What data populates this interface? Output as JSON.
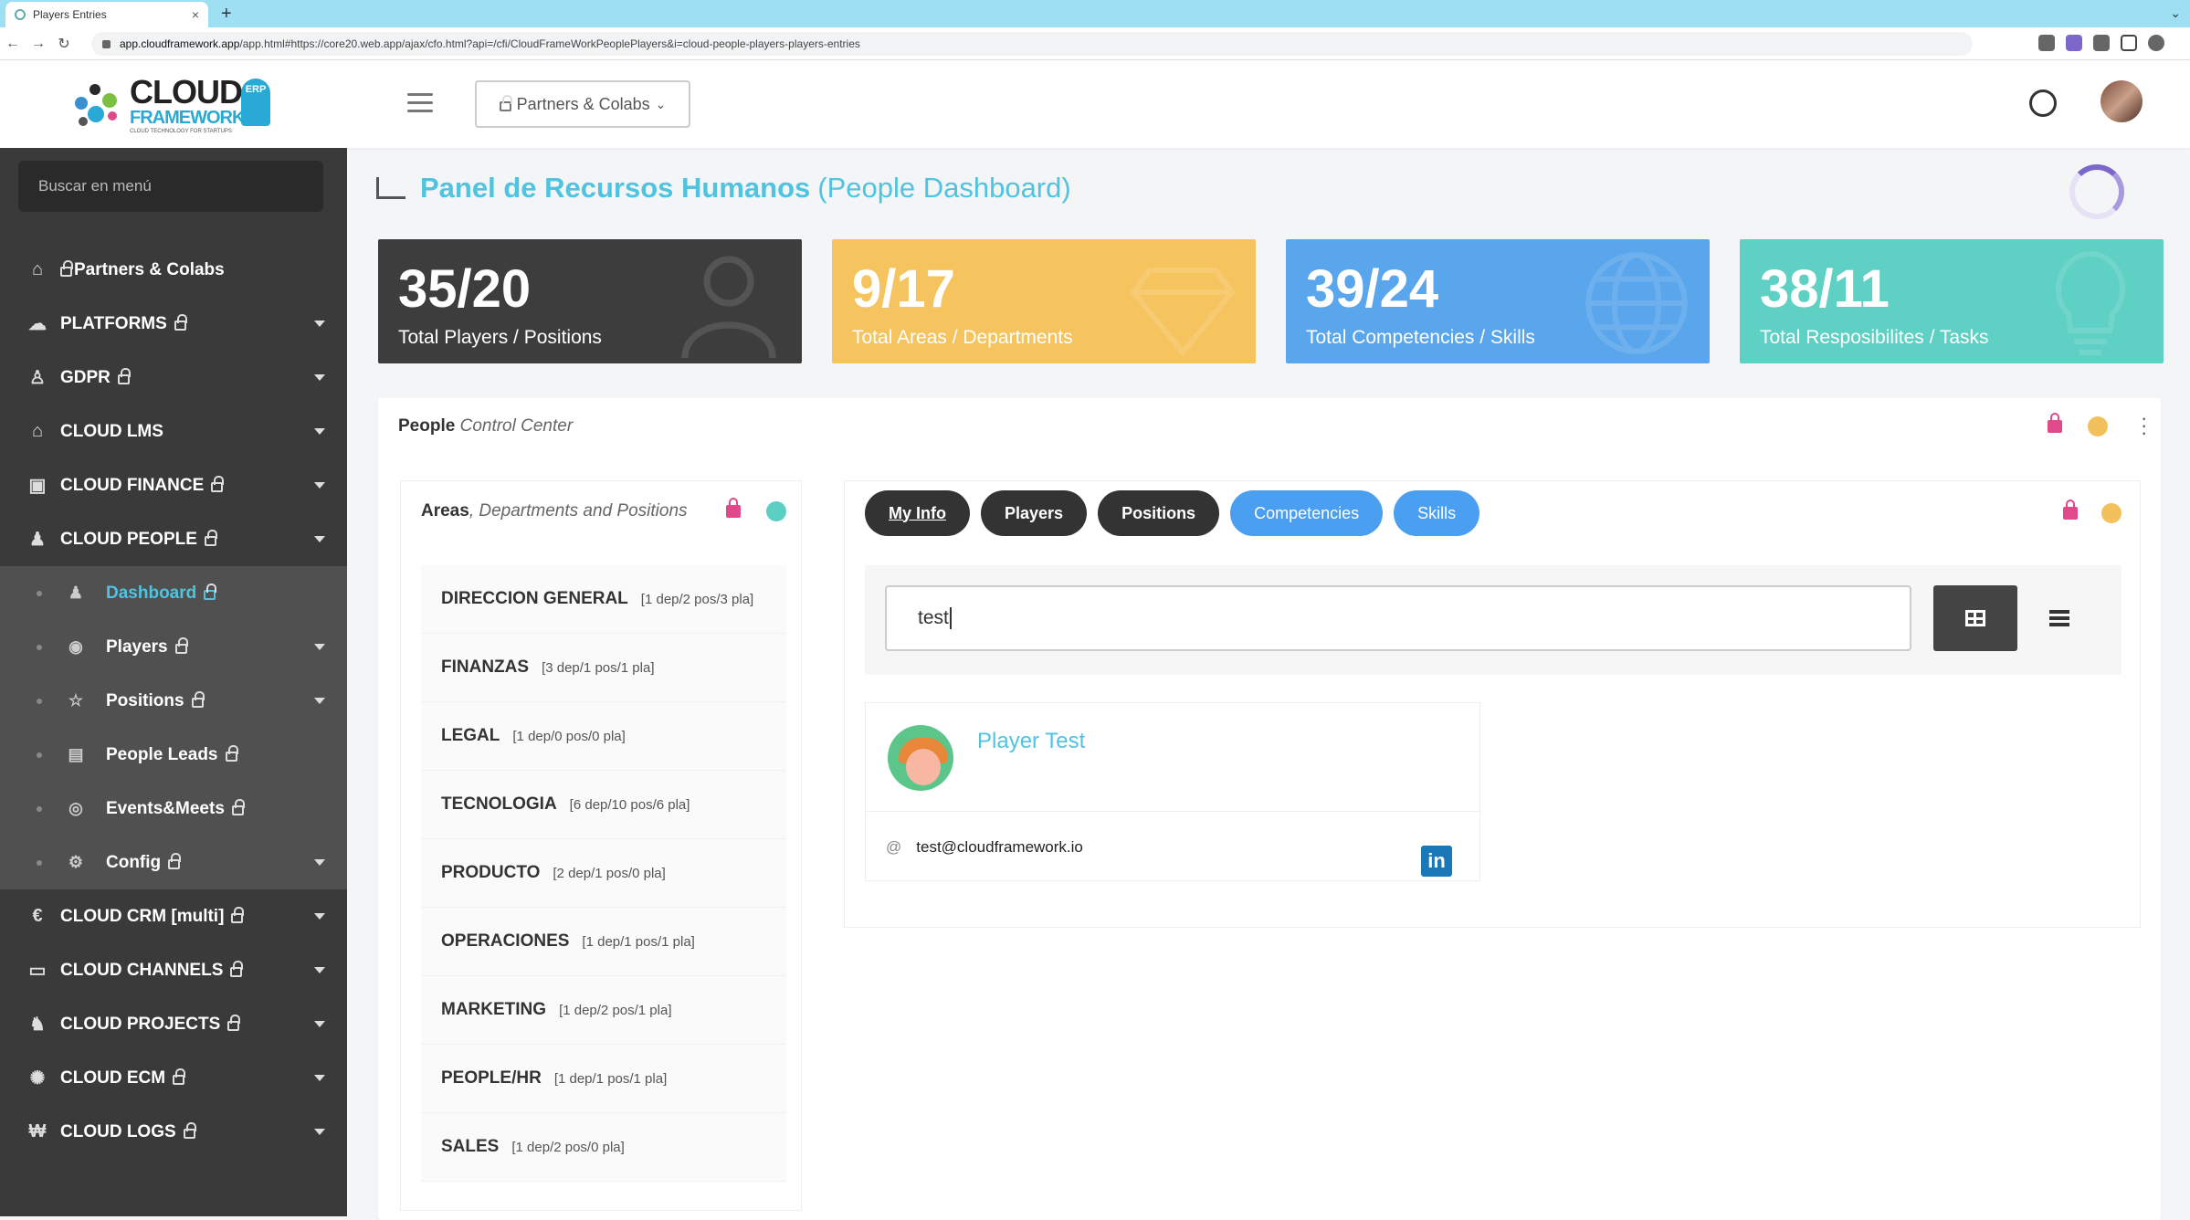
{
  "browser": {
    "tab_title": "Players Entries",
    "url_host": "app.cloudframework.app",
    "url_rest": "/app.html#https://core20.web.app/ajax/cfo.html?api=/cfi/CloudFrameWorkPeoplePlayers&i=cloud-people-players-players-entries"
  },
  "header": {
    "logo_line1": "CLOUD",
    "logo_line2": "FRAMEWORK",
    "logo_tagline": "CLOUD TECHNOLOGY FOR STARTUPS",
    "logo_badge": "ERP",
    "partners_dropdown": "Partners & Colabs"
  },
  "sidebar": {
    "search_placeholder": "Buscar en menú",
    "items": [
      {
        "label": "Partners & Colabs",
        "icon": "home-icon"
      },
      {
        "label": "PLATFORMS",
        "icon": "cloud-icon"
      },
      {
        "label": "GDPR",
        "icon": "user-shield-icon"
      },
      {
        "label": "CLOUD LMS",
        "icon": "graduation-cap-icon"
      },
      {
        "label": "CLOUD FINANCE",
        "icon": "money-icon"
      },
      {
        "label": "CLOUD PEOPLE",
        "icon": "people-icon"
      }
    ],
    "sub_items": [
      {
        "label": "Dashboard",
        "icon": "people-icon"
      },
      {
        "label": "Players",
        "icon": "user-circle-icon"
      },
      {
        "label": "Positions",
        "icon": "star-icon"
      },
      {
        "label": "People Leads",
        "icon": "id-card-icon"
      },
      {
        "label": "Events&Meets",
        "icon": "target-icon"
      },
      {
        "label": "Config",
        "icon": "gear-icon"
      }
    ],
    "items_after": [
      {
        "label": "CLOUD CRM [multi]",
        "icon": "euro-icon"
      },
      {
        "label": "CLOUD CHANNELS",
        "icon": "chat-icon"
      },
      {
        "label": "CLOUD PROJECTS",
        "icon": "team-icon"
      },
      {
        "label": "CLOUD ECM",
        "icon": "network-icon"
      },
      {
        "label": "CLOUD LOGS",
        "icon": "logs-icon"
      }
    ]
  },
  "page": {
    "title": "Panel de Recursos Humanos",
    "subtitle": "(People Dashboard)"
  },
  "stats": [
    {
      "value": "35/20",
      "label": "Total Players / Positions",
      "color": "#3d3d3d",
      "icon": "user-icon"
    },
    {
      "value": "9/17",
      "label": "Total Areas / Departments",
      "color": "#f6c45e",
      "icon": "diamond-icon"
    },
    {
      "value": "39/24",
      "label": "Total Competencies / Skills",
      "color": "#5aa6ec",
      "icon": "globe-icon"
    },
    {
      "value": "38/11",
      "label": "Total Resposibilites / Tasks",
      "color": "#5fd0c4",
      "icon": "lightbulb-icon"
    }
  ],
  "control_center": {
    "title": "People",
    "title_italic": "Control Center"
  },
  "areas": {
    "title": "Areas",
    "title_italic": ", Departments and Positions",
    "rows": [
      {
        "name": "DIRECCION GENERAL",
        "meta": "[1 dep/2 pos/3 pla]"
      },
      {
        "name": "FINANZAS",
        "meta": "[3 dep/1 pos/1 pla]"
      },
      {
        "name": "LEGAL",
        "meta": "[1 dep/0 pos/0 pla]"
      },
      {
        "name": "TECNOLOGIA",
        "meta": "[6 dep/10 pos/6 pla]"
      },
      {
        "name": "PRODUCTO",
        "meta": "[2 dep/1 pos/0 pla]"
      },
      {
        "name": "OPERACIONES",
        "meta": "[1 dep/1 pos/1 pla]"
      },
      {
        "name": "MARKETING",
        "meta": "[1 dep/2 pos/1 pla]"
      },
      {
        "name": "PEOPLE/HR",
        "meta": "[1 dep/1 pos/1 pla]"
      },
      {
        "name": "SALES",
        "meta": "[1 dep/2 pos/0 pla]"
      }
    ]
  },
  "people_panel": {
    "tabs": [
      "My Info",
      "Players",
      "Positions",
      "Competencies",
      "Skills"
    ],
    "search_value": "test",
    "player": {
      "name": "Player Test",
      "email": "test@cloudframework.io",
      "linkedin": "in"
    }
  }
}
